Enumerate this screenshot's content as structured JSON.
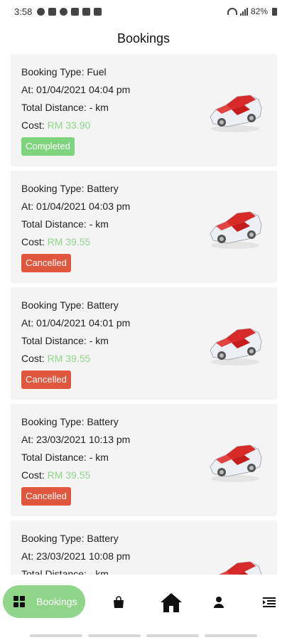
{
  "status_bar": {
    "time": "3:58",
    "battery": "82%",
    "icons": [
      "whatsapp-icon",
      "save-icon",
      "clock-icon",
      "flipboard-icon",
      "gallery-icon",
      "mail-icon"
    ]
  },
  "header": {
    "title": "Bookings"
  },
  "bookings": [
    {
      "type_label": "Booking Type: Fuel",
      "at_label": "At: 01/04/2021 04:04 pm",
      "distance_label": "Total Distance: - km",
      "cost_label": "Cost:",
      "cost_value": "RM 33.90",
      "status": "Completed",
      "status_color": "#7fd47e"
    },
    {
      "type_label": "Booking Type: Battery",
      "at_label": "At: 01/04/2021 04:03 pm",
      "distance_label": "Total Distance: - km",
      "cost_label": "Cost:",
      "cost_value": "RM 39.55",
      "status": "Cancelled",
      "status_color": "#e0573e"
    },
    {
      "type_label": "Booking Type: Battery",
      "at_label": "At: 01/04/2021 04:01 pm",
      "distance_label": "Total Distance: - km",
      "cost_label": "Cost:",
      "cost_value": "RM 39.55",
      "status": "Cancelled",
      "status_color": "#e0573e"
    },
    {
      "type_label": "Booking Type: Battery",
      "at_label": "At: 23/03/2021 10:13 pm",
      "distance_label": "Total Distance: - km",
      "cost_label": "Cost:",
      "cost_value": "RM 39.55",
      "status": "Cancelled",
      "status_color": "#e0573e"
    },
    {
      "type_label": "Booking Type: Battery",
      "at_label": "At: 23/03/2021 10:08 pm",
      "distance_label": "Total Distance: - km",
      "cost_label": "",
      "cost_value": "",
      "status": "",
      "status_color": ""
    }
  ],
  "bottom_nav": {
    "active_label": "Bookings",
    "items": [
      "grid-icon",
      "bag-icon",
      "home-icon",
      "person-icon",
      "menu-icon"
    ]
  },
  "colors": {
    "accent_green": "#8fd68a",
    "cancelled_red": "#e0573e",
    "card_background": "#f4f4f4"
  }
}
